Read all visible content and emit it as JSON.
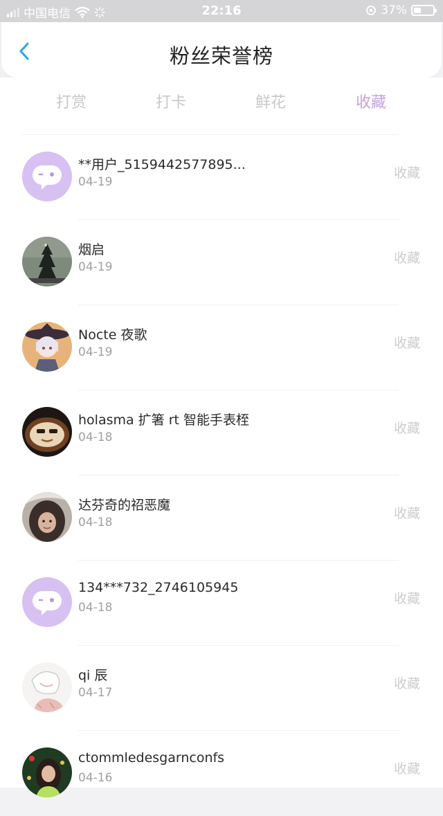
{
  "status_bar": {
    "carrier": "中国电信",
    "time": "22:16",
    "battery": "37%",
    "battery_level": 0.37
  },
  "header": {
    "back_icon": "chevron-left-icon",
    "title": "粉丝荣誉榜"
  },
  "tabs": [
    {
      "label": "打赏",
      "active": false
    },
    {
      "label": "打卡",
      "active": false
    },
    {
      "label": "鲜花",
      "active": false
    },
    {
      "label": "收藏",
      "active": true
    }
  ],
  "colors": {
    "accent": "#c6a1de",
    "default_avatar": "#d7c0f2",
    "muted_text": "#cdcdcf",
    "date_text": "#a0a0a2"
  },
  "list": [
    {
      "name": "**用户_5159442577895...",
      "date": "04-19",
      "action": "收藏",
      "avatar": "default-chat-bubble-avatar"
    },
    {
      "name": "烟启",
      "date": "04-19",
      "action": "收藏",
      "avatar": "dark-silhouette-photo"
    },
    {
      "name": "Nocte 夜歌",
      "date": "04-19",
      "action": "收藏",
      "avatar": "anime-character-witch-hat"
    },
    {
      "name": "holasma 扩箸 rt 智能手表桎",
      "date": "04-18",
      "action": "收藏",
      "avatar": "latte-art-cup"
    },
    {
      "name": "达芬奇的祒恶魔",
      "date": "04-18",
      "action": "收藏",
      "avatar": "girl-photo"
    },
    {
      "name": "134***732_2746105945",
      "date": "04-18",
      "action": "收藏",
      "avatar": "default-chat-bubble-avatar"
    },
    {
      "name": "qi 辰",
      "date": "04-17",
      "action": "收藏",
      "avatar": "sketch-girl-drawing"
    },
    {
      "name": "ctommledesgarnconfs",
      "date": "04-16",
      "action": "收藏",
      "avatar": "christmas-girl-photo"
    }
  ]
}
